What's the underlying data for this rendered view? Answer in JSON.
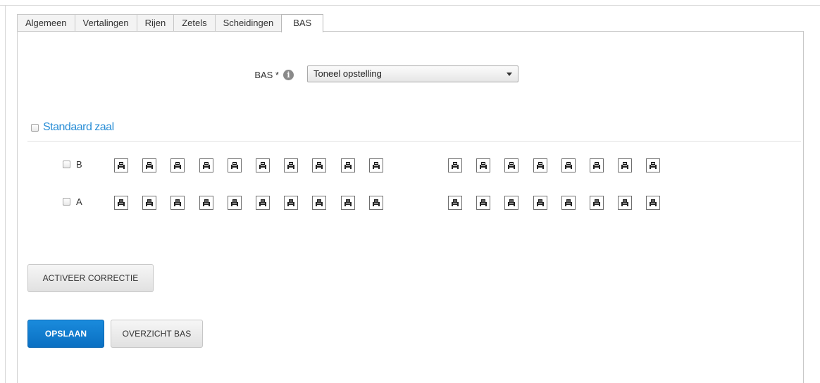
{
  "tabs": [
    {
      "label": "Algemeen",
      "active": false
    },
    {
      "label": "Vertalingen",
      "active": false
    },
    {
      "label": "Rijen",
      "active": false
    },
    {
      "label": "Zetels",
      "active": false
    },
    {
      "label": "Scheidingen",
      "active": false
    },
    {
      "label": "BAS",
      "active": true
    }
  ],
  "bas_field": {
    "label": "BAS *",
    "info_icon": "info-icon",
    "selected": "Toneel opstelling"
  },
  "standard_hall": {
    "label": "Standaard zaal",
    "checked": false
  },
  "seat_rows": [
    {
      "label": "B",
      "left_block_seats": 10,
      "right_block_seats": 8,
      "checked": false
    },
    {
      "label": "A",
      "left_block_seats": 10,
      "right_block_seats": 8,
      "checked": false
    }
  ],
  "buttons": {
    "activate_correction": "ACTIVEER CORRECTIE",
    "save": "OPSLAAN",
    "overview": "OVERZICHT BAS"
  },
  "colors": {
    "accent_link": "#2a8ed6",
    "primary_button": "#0a79cf"
  }
}
